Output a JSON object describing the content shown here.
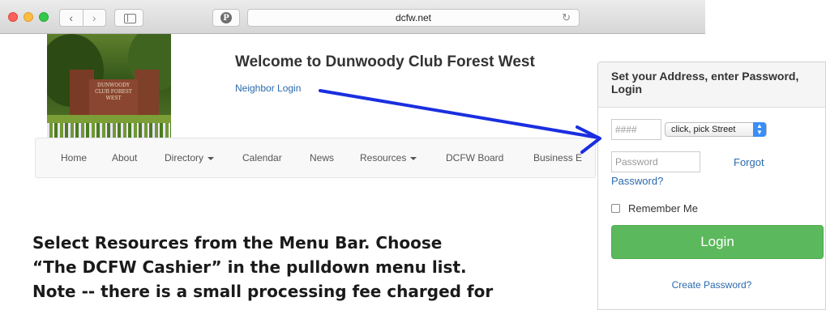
{
  "browser": {
    "url": "dcfw.net",
    "back_glyph": "‹",
    "forward_glyph": "›",
    "pinterest_glyph": "P",
    "reload_glyph": "↻"
  },
  "site": {
    "welcome_title": "Welcome to Dunwoody Club Forest West",
    "neighbor_login": "Neighbor Login",
    "photo_sign": [
      "DUNWOODY",
      "CLUB FOREST",
      "WEST"
    ]
  },
  "nav": {
    "items": [
      {
        "label": "Home",
        "dropdown": false
      },
      {
        "label": "About",
        "dropdown": false
      },
      {
        "label": "Directory",
        "dropdown": true
      },
      {
        "label": "Calendar",
        "dropdown": false
      },
      {
        "label": "News",
        "dropdown": false
      },
      {
        "label": "Resources",
        "dropdown": true
      },
      {
        "label": "DCFW Board",
        "dropdown": false
      },
      {
        "label": "Business E",
        "dropdown": false
      }
    ]
  },
  "login_panel": {
    "heading_line1": "Set your Address, enter Password,",
    "heading_line2": "Login",
    "house_number_placeholder": "####",
    "street_select_value": "click, pick Street",
    "password_placeholder": "Password",
    "forgot_part1": "Forgot",
    "forgot_part2": "Password?",
    "remember_label": "Remember Me",
    "login_button": "Login",
    "create_password": "Create Password?"
  },
  "instructions": {
    "line1": "Select Resources from the Menu Bar.  Choose",
    "line2": "“The DCFW Cashier” in the pulldown menu list.",
    "line3": "Note -- there is a small processing fee charged for"
  },
  "colors": {
    "link": "#2a6aad",
    "login_button": "#5cb85c",
    "annotation_arrow": "#1a2ee0"
  }
}
